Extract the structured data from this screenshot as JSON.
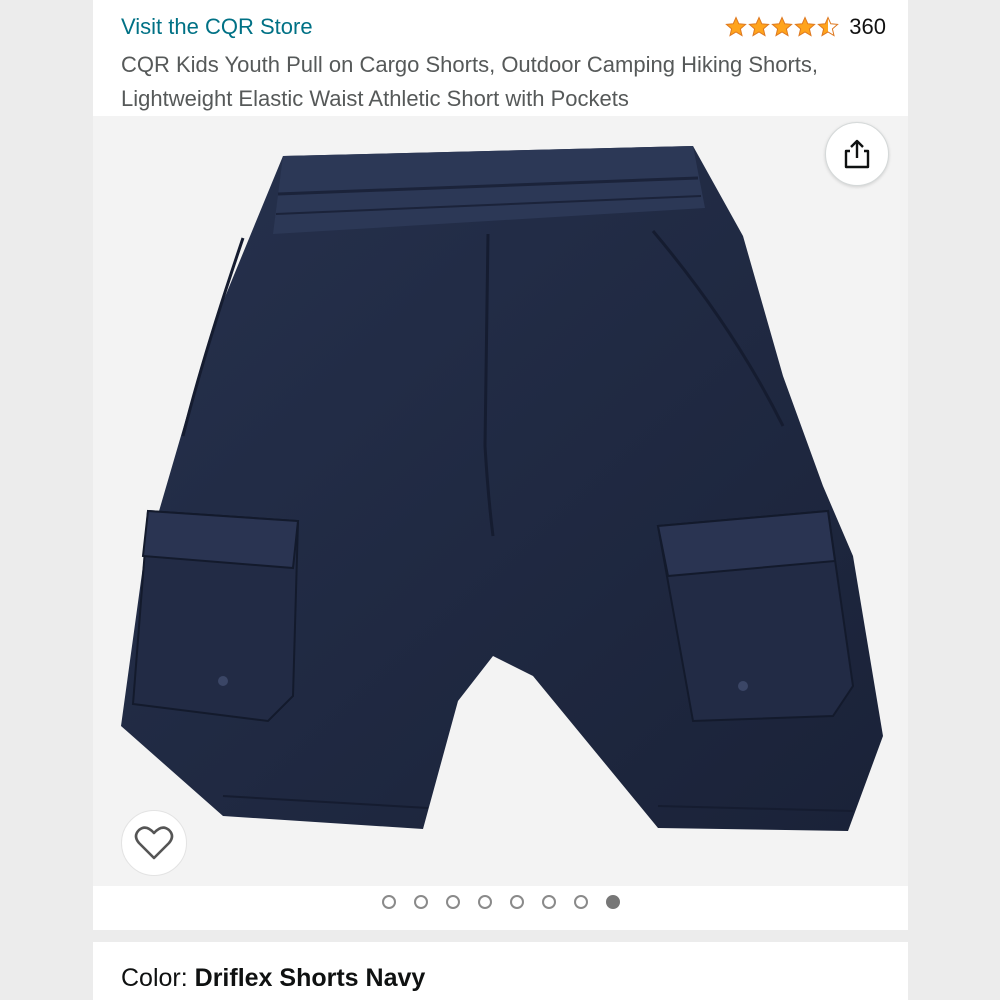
{
  "store": {
    "link_text": "Visit the CQR Store"
  },
  "rating": {
    "stars": 4.5,
    "count": "360",
    "star_color": "#FFA41C"
  },
  "product": {
    "title": "CQR Kids Youth Pull on Cargo Shorts, Outdoor Camping Hiking Shorts, Lightweight Elastic Waist Athletic Short with Pockets",
    "image_color": "#1f2a44"
  },
  "gallery": {
    "total_images": 8,
    "active_index": 7
  },
  "icons": {
    "share": "share-icon",
    "favorite": "heart-icon"
  },
  "variant": {
    "label": "Color: ",
    "value": "Driflex Shorts Navy"
  },
  "colors": {
    "link": "#007185",
    "title": "#565959",
    "page_bg": "#ececec"
  }
}
